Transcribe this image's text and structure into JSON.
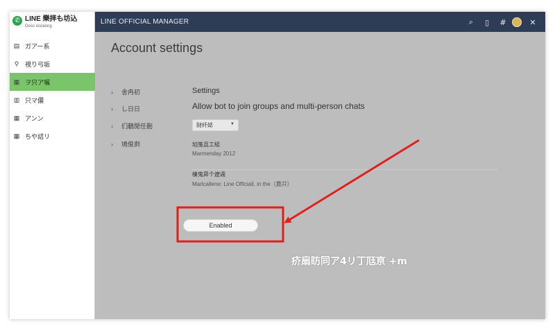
{
  "app": {
    "logo_mark": "✆",
    "logo_title": "LINE 樂拝も坊込",
    "logo_subtitle": "Ooss ocoanng"
  },
  "sidebar": {
    "items": [
      {
        "icon": "▤",
        "label": "ガアー系",
        "active": false
      },
      {
        "icon": "⚲",
        "label": "視り弓垢",
        "active": false
      },
      {
        "icon": "▦",
        "label": "ヲ只ア嘱",
        "active": true
      },
      {
        "icon": "▥",
        "label": "只マ儂",
        "active": false
      },
      {
        "icon": "▦",
        "label": "アンン",
        "active": false
      },
      {
        "icon": "▦",
        "label": "ちや詰リ",
        "active": false
      }
    ]
  },
  "topbar": {
    "title": "LINE OFFICIAL MANAGER",
    "icons": {
      "search": "⌕",
      "device": "▯",
      "hash": "#",
      "close": "✕"
    }
  },
  "main": {
    "page_title": "Account settings",
    "sections": [
      {
        "label": "舎冉初"
      },
      {
        "label": "し日日"
      },
      {
        "label": "们鵏閒任刪"
      },
      {
        "label": "鳩俊㓟"
      }
    ],
    "settings_heading": "Settings",
    "allow_bot_text": "Allow bot to join groups and multi-person chats",
    "dropdown_value": "财纤娡",
    "info1_label": "垍笺且工組",
    "info1_value": "Marmenday 2012",
    "info2_label": "棲鬼昇个遼週",
    "info2_value": "Marlcallene: Line Officiall, in the（農𦬇）",
    "enabled_button": "Enabled"
  },
  "annotation": {
    "text": "疥扇眆同ア4リ丁尫亰 +m",
    "color": "#e0201b"
  }
}
